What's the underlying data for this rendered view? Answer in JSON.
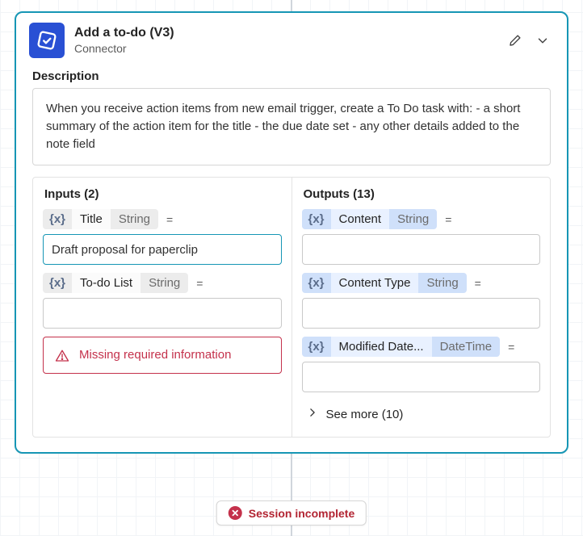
{
  "header": {
    "title": "Add a to-do (V3)",
    "subtitle": "Connector"
  },
  "description": {
    "label": "Description",
    "text": "When you receive action items from new email trigger, create a To Do task with: - a short summary of the action item for the title - the due date set - any other details added to the note field"
  },
  "inputs": {
    "heading": "Inputs (2)",
    "fx": "{x}",
    "eq": "=",
    "items": [
      {
        "name": "Title",
        "type": "String",
        "value": "Draft proposal for paperclip",
        "selected": true
      },
      {
        "name": "To-do List",
        "type": "String",
        "value": ""
      }
    ],
    "error": "Missing required information"
  },
  "outputs": {
    "heading": "Outputs (13)",
    "fx": "{x}",
    "eq": "=",
    "items": [
      {
        "name": "Content",
        "type": "String",
        "value": ""
      },
      {
        "name": "Content Type",
        "type": "String",
        "value": ""
      },
      {
        "name": "Modified Date...",
        "type": "DateTime",
        "value": ""
      }
    ],
    "see_more": "See more (10)"
  },
  "session": {
    "text": "Session incomplete"
  }
}
